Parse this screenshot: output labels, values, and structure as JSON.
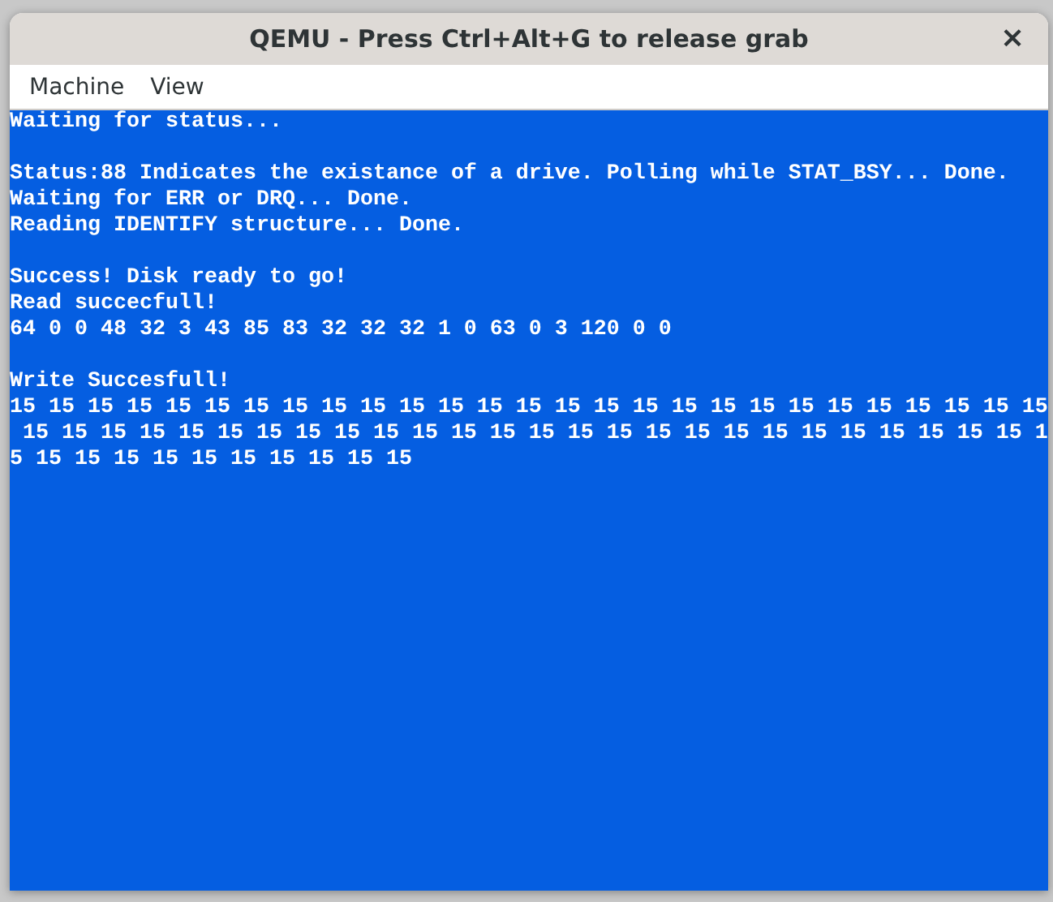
{
  "window": {
    "title": "QEMU - Press Ctrl+Alt+G to release grab",
    "close": "×"
  },
  "menu": [
    "Machine",
    "View"
  ],
  "screen": {
    "paragraphs": [
      {
        "lines": [
          "Waiting for status..."
        ]
      },
      {
        "lines": [
          "Status:88 Indicates the existance of a drive. Polling while STAT_BSY... Done.",
          "Waiting for ERR or DRQ... Done.",
          "Reading IDENTIFY structure... Done."
        ]
      },
      {
        "lines": [
          "Success! Disk ready to go!",
          "Read succecfull!",
          "64 0 0 48 32 3 43 85 83 32 32 32 1 0 63 0 3 120 0 0"
        ]
      },
      {
        "lines": [
          "Write Succesfull!",
          "15 15 15 15 15 15 15 15 15 15 15 15 15 15 15 15 15 15 15 15 15 15 15 15 15 15 15",
          " 15 15 15 15 15 15 15 15 15 15 15 15 15 15 15 15 15 15 15 15 15 15 15 15 15 15 1",
          "5 15 15 15 15 15 15 15 15 15 15"
        ]
      }
    ]
  }
}
